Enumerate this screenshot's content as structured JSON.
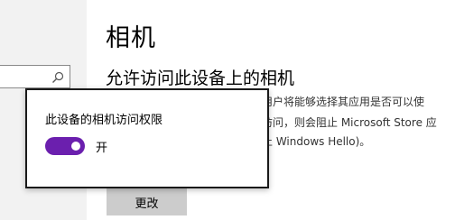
{
  "page": {
    "title": "相机"
  },
  "section": {
    "heading": "允许访问此设备上的相机"
  },
  "description": {
    "line1": "用户将能够选择其应用是否可以使",
    "line2": "访问，则会阻止 Microsoft Store 应",
    "line3": "止 Windows Hello)。"
  },
  "change_button": {
    "label": "更改"
  },
  "popup": {
    "label": "此设备的相机访问权限",
    "toggle_on": true,
    "toggle_state": "开",
    "accent_color": "#6b1fae"
  },
  "search": {
    "icon": "search-icon"
  }
}
